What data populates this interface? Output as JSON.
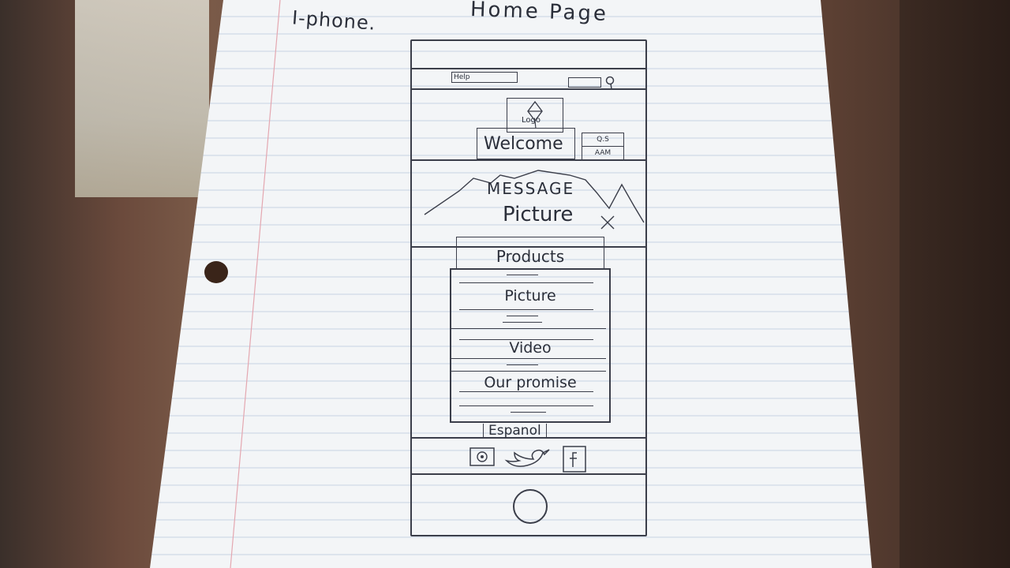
{
  "page": {
    "title": "Home Page",
    "device": "I-phone."
  },
  "wireframe": {
    "header": {
      "search_text": "Help",
      "logo_label": "Logo",
      "welcome": "Welcome",
      "lang_buttons": [
        "Q.S",
        "AAM"
      ]
    },
    "hero": {
      "message": "MESSAGE",
      "picture": "Picture"
    },
    "products": {
      "title": "Products",
      "items": [
        "Picture",
        "Video",
        "Our promise"
      ]
    },
    "language_link": "Espanol",
    "social_icons": [
      "instagram-icon",
      "twitter-icon",
      "facebook-icon"
    ],
    "home_button": "home-button"
  },
  "colors": {
    "ink": "#2b2f3a",
    "paper": "#f3f5f7",
    "background": "#5c4033"
  }
}
